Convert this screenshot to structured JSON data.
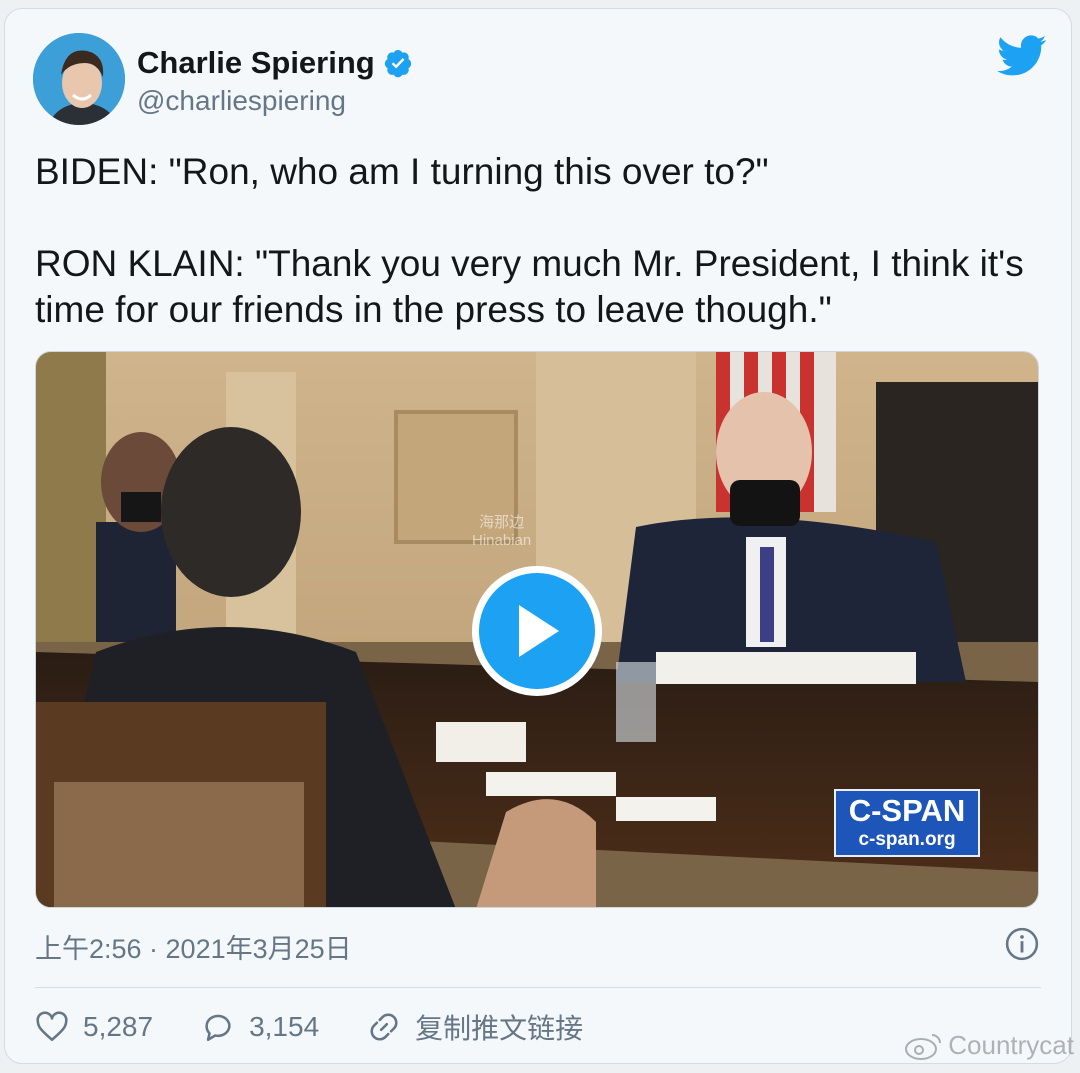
{
  "author": {
    "name": "Charlie Spiering",
    "handle": "@charliespiering",
    "verified": true
  },
  "tweet": {
    "text": "BIDEN: \"Ron, who am I turning this over to?\"\n\nRON KLAIN: \"Thank you very much Mr. President, I think it's time for our friends in the press to leave though.\""
  },
  "media": {
    "type": "video",
    "broadcaster_logo": "C-SPAN",
    "broadcaster_url": "c-span.org",
    "watermark_cn": "海那边",
    "watermark_en": "Hinabian"
  },
  "meta": {
    "timestamp": "上午2:56 · 2021年3月25日"
  },
  "actions": {
    "likes": "5,287",
    "replies": "3,154",
    "copy_link": "复制推文链接"
  },
  "credit": {
    "text": "Countrycat"
  },
  "icons": {
    "verified": "verified-badge-icon",
    "bird": "twitter-bird-icon",
    "info": "info-icon",
    "like": "heart-icon",
    "reply": "reply-bubble-icon",
    "link": "link-icon",
    "play": "play-icon",
    "weibo": "weibo-icon"
  },
  "colors": {
    "brand_blue": "#1da1f2",
    "text_primary": "#14171a",
    "text_secondary": "#657786"
  }
}
